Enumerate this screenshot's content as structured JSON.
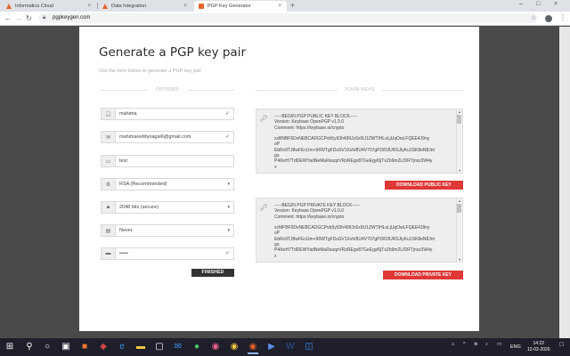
{
  "browser": {
    "tabs": [
      {
        "label": "Informatica Cloud",
        "active": false
      },
      {
        "label": "Data Integration",
        "active": false
      },
      {
        "label": "PGP Key Generator",
        "active": true
      }
    ],
    "url": "pgpkeygen.com",
    "close_glyph": "×",
    "newtab_glyph": "+",
    "win_min": "–",
    "win_max": "□",
    "win_close": "×"
  },
  "page": {
    "title": "Generate a PGP key pair",
    "subtitle": "Use the form below to generate a PGP key pair",
    "options_heading": "OPTIONS",
    "keys_heading": "YOUR KEYS",
    "fields": [
      {
        "icon": "user-icon",
        "value": "mahima",
        "trailing": "✓"
      },
      {
        "icon": "email-icon",
        "value": "mahimareddynagai6@gmail.com",
        "trailing": "✓"
      },
      {
        "icon": "comment-icon",
        "value": "test",
        "trailing": ""
      },
      {
        "icon": "algorithm-icon",
        "value": "RSA (Recommended)",
        "trailing": "▾"
      },
      {
        "icon": "key-size-icon",
        "value": "2048 bits (secure)",
        "trailing": "▾"
      },
      {
        "icon": "expires-icon",
        "value": "Never",
        "trailing": "▾"
      },
      {
        "icon": "passphrase-icon",
        "value": "•••••",
        "trailing": "✓"
      }
    ],
    "finished_label": "FINISHED",
    "public_key_text": "-----BEGIN PGP PUBLIC KEY BLOCK-----\nVersion: Keybase OpenPGP v1.0.0\nComment: https://keybase.io/crypto\n\nxsBNBF5DvNEBCADGCPvb5y93h499Jc6x9U1ZWTIHLsLjUqOwLFQEE4J9ny\noP\nEbRv9TJ8wFEcUm+96WTgFDuSV1Xvh/8U4V707gPD81fURSJlyKu1SK8eN8Jnt\ngu\nP4/ksH7TdDEWYadNeMuRsuqzVRzREgo87GeEgyl6jTvZb9m2L/DRTjnxz3W4y\nx",
    "download_public_label": "DOWNLOAD PUBLIC KEY",
    "private_key_text": "-----BEGIN PGP PRIVATE KEY BLOCK-----\nVersion: Keybase OpenPGP v1.0.0\nComment: https://keybase.io/crypto\n\nxcMFBF5DvNEBCADGCPvb5y93h499Jc6x9U1ZWTIHLsLjUqOwLFQEE4J9ny\noP\nEbRv9TJ8wFEcUm+96WTgFDuSV1Xvh/8U4V707gPD81fURSJlyKu1SK8eN8Jnt\ngu\nP4/ksH7TdDEWYadNeMuRsuqzVRzREgo87GeEgyl6jTvZb9m2L/DRTjnxz3W4y\nx",
    "download_private_label": "DOWNLOAD PRIVATE KEY"
  },
  "taskbar": {
    "language": "ENG",
    "time": "14:22",
    "date": "12-02-2020"
  },
  "colors": {
    "accent_red": "#e03737",
    "finished_bg": "#333333"
  }
}
